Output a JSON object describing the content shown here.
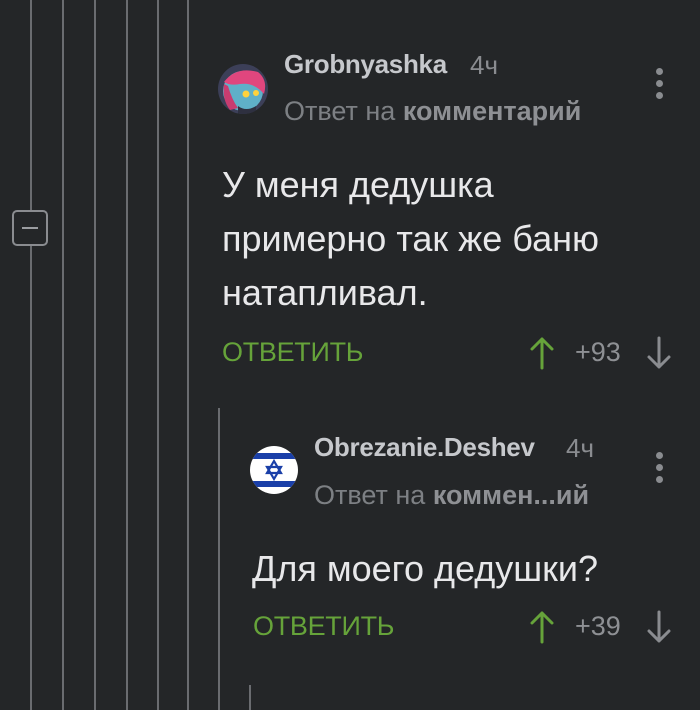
{
  "comments": [
    {
      "username": "Grobnyashka",
      "time": "4ч",
      "reply_prefix": "Ответ на",
      "reply_link": "комментарий",
      "body_lines": [
        "У меня дедушка",
        "примерно так же баню",
        "натапливал."
      ],
      "reply_label": "ОТВЕТИТЬ",
      "score": "+93",
      "avatar_icon": "anime-avatar-icon"
    },
    {
      "username": "Obrezanie.Deshev",
      "time": "4ч",
      "reply_prefix": "Ответ на",
      "reply_link": "коммен...ий",
      "body_lines": [
        "Для моего дедушки?"
      ],
      "reply_label": "ОТВЕТИТЬ",
      "score": "+39",
      "avatar_icon": "israel-flag-icon"
    }
  ],
  "colors": {
    "background": "#242628",
    "reply_green": "#66a33a",
    "thread_line": "#6a6c70"
  }
}
